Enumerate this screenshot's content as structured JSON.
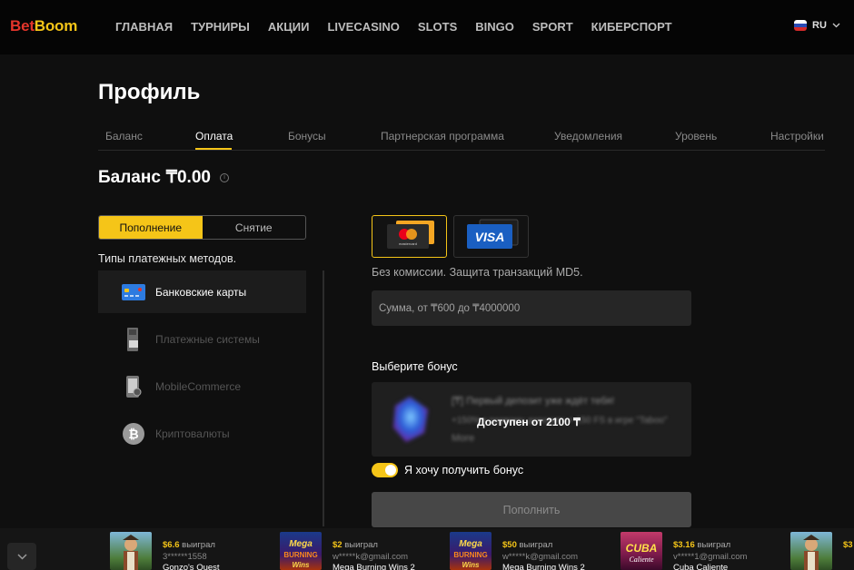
{
  "brand": {
    "part1": "Bet",
    "part2": "Boom"
  },
  "nav": [
    "ГЛАВНАЯ",
    "ТУРНИРЫ",
    "АКЦИИ",
    "LIVECASINO",
    "SLOTS",
    "BINGO",
    "SPORT",
    "КИБЕРСПОРТ"
  ],
  "lang": {
    "code": "RU",
    "icon": "flag-russia-icon"
  },
  "page": {
    "title": "Профиль"
  },
  "tabs": [
    "Баланс",
    "Оплата",
    "Бонусы",
    "Партнерская программа",
    "Уведомления",
    "Уровень",
    "Настройки"
  ],
  "active_tab": "Оплата",
  "balance": {
    "label": "Баланс",
    "value": "₸0.00"
  },
  "deposit_toggle": {
    "deposit": "Пополнение",
    "withdraw": "Снятие",
    "active": "Пополнение"
  },
  "methods": {
    "title": "Типы платежных методов.",
    "items": [
      {
        "label": "Банковские карты",
        "icon": "bank-card-icon"
      },
      {
        "label": "Платежные системы",
        "icon": "payment-terminal-icon"
      },
      {
        "label": "MobileCommerce",
        "icon": "mobile-phone-icon"
      },
      {
        "label": "Криптовалюты",
        "icon": "bitcoin-icon"
      }
    ]
  },
  "card_options": [
    {
      "label": "mastercard",
      "icon": "mastercard-icon"
    },
    {
      "label": "VISA",
      "icon": "visa-icon"
    }
  ],
  "payment": {
    "note": "Без комиссии. Защита транзакций MD5.",
    "amount_placeholder": "Сумма, от ₸600 до ₸4000000",
    "bonus_title": "Выберите бонус",
    "bonus_line1": "[₸] Первый депозит уже ждёт тебя!",
    "bonus_line2": "+150% к первому депозиту + 150 FS в игре \"Taboo\"",
    "bonus_line3": "Моге",
    "bonus_available": "Доступен от 2100 ₸",
    "checkbox_label": "Я хочу получить бонус",
    "submit": "Пополнить"
  },
  "colors": {
    "accent": "#f5c518",
    "brand_red": "#e4352b",
    "bg": "#0f0f0f"
  },
  "ticker": {
    "won_label": "выиграл",
    "items": [
      {
        "amount": "$6.6",
        "user": "3******1558",
        "game": "Gonzo's Quest"
      },
      {
        "amount": "$2",
        "user": "w*****k@gmail.com",
        "game": "Mega Burning Wins 2"
      },
      {
        "amount": "$50",
        "user": "w*****k@gmail.com",
        "game": "Mega Burning Wins 2"
      },
      {
        "amount": "$3.16",
        "user": "v*****1@gmail.com",
        "game": "Cuba Caliente"
      },
      {
        "amount": "$3",
        "user": "",
        "game": ""
      }
    ]
  }
}
